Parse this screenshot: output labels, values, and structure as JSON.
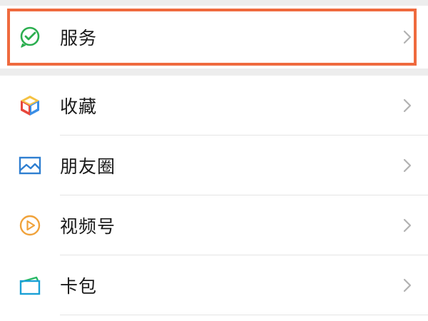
{
  "colors": {
    "page_background": "#ededed",
    "row_background": "#ffffff",
    "highlight": "#ef6a3e",
    "chevron": "#b2b2b2",
    "divider": "#e5e5e5",
    "service_icon": "#2bae4f",
    "moments_icon": "#2f7fd1",
    "channels_icon": "#f0a23a",
    "cards_icon": "#1aa0d6"
  },
  "menu": {
    "service": {
      "label": "服务",
      "icon": "service-icon"
    },
    "items": [
      {
        "label": "收藏",
        "icon": "favorites-cube-icon"
      },
      {
        "label": "朋友圈",
        "icon": "moments-picture-icon"
      },
      {
        "label": "视频号",
        "icon": "channels-play-icon"
      },
      {
        "label": "卡包",
        "icon": "card-wallet-icon"
      }
    ]
  }
}
